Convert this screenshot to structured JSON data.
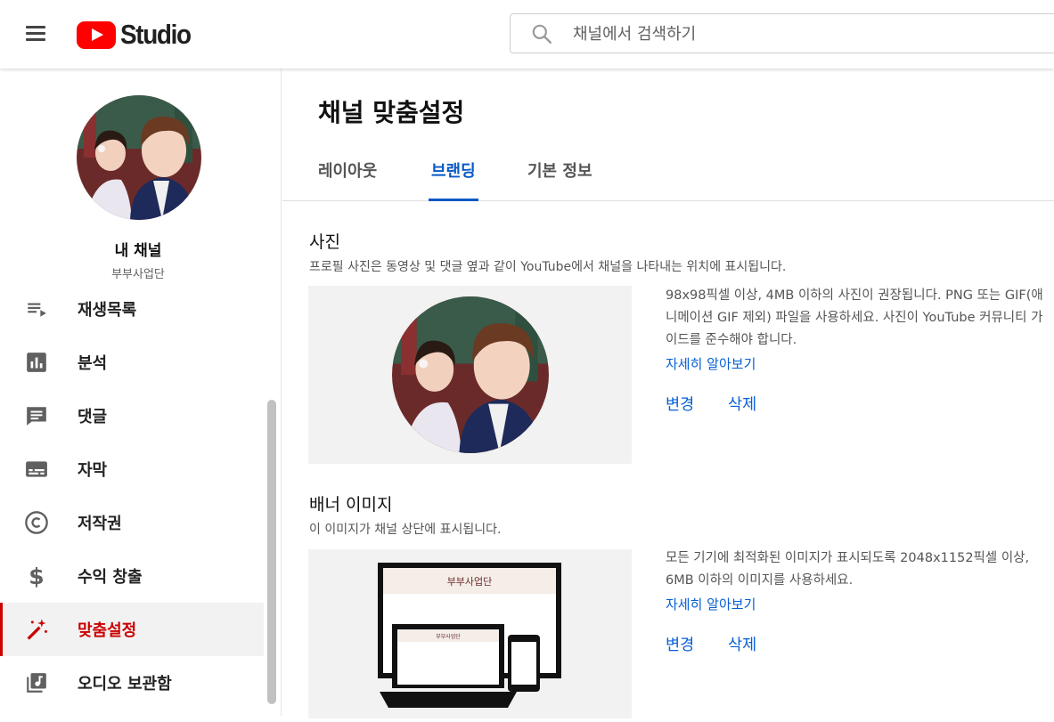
{
  "header": {
    "logo_text": "Studio",
    "search_placeholder": "채널에서 검색하기"
  },
  "sidebar": {
    "channel_label": "내 채널",
    "channel_name": "부부사업단",
    "items": [
      {
        "label": "재생목록",
        "icon": "playlist-icon"
      },
      {
        "label": "분석",
        "icon": "analytics-icon"
      },
      {
        "label": "댓글",
        "icon": "comments-icon"
      },
      {
        "label": "자막",
        "icon": "subtitles-icon"
      },
      {
        "label": "저작권",
        "icon": "copyright-icon"
      },
      {
        "label": "수익 창출",
        "icon": "dollar-icon"
      },
      {
        "label": "맞춤설정",
        "icon": "magic-wand-icon",
        "active": true
      },
      {
        "label": "오디오 보관함",
        "icon": "audio-library-icon"
      }
    ]
  },
  "main": {
    "title": "채널 맞춤설정",
    "tabs": [
      {
        "label": "레이아웃"
      },
      {
        "label": "브랜딩",
        "active": true
      },
      {
        "label": "기본 정보"
      }
    ],
    "photo": {
      "title": "사진",
      "desc": "프로필 사진은 동영상 및 댓글 옆과 같이 YouTube에서 채널을 나타내는 위치에 표시됩니다.",
      "info": "98x98픽셀 이상, 4MB 이하의 사진이 권장됩니다. PNG 또는 GIF(애니메이션 GIF 제외) 파일을 사용하세요. 사진이 YouTube 커뮤니티 가이드를 준수해야 합니다.",
      "learn_more": "자세히 알아보기",
      "change": "변경",
      "delete": "삭제"
    },
    "banner": {
      "title": "배너 이미지",
      "desc": "이 이미지가 채널 상단에 표시됩니다.",
      "info": "모든 기기에 최적화된 이미지가 표시되도록 2048x1152픽셀 이상, 6MB 이하의 이미지를 사용하세요.",
      "learn_more": "자세히 알아보기",
      "change": "변경",
      "delete": "삭제",
      "banner_text": "부부사업단"
    }
  },
  "colors": {
    "accent_blue": "#065fd4",
    "active_red": "#cc0000",
    "logo_red": "#ff0000"
  }
}
